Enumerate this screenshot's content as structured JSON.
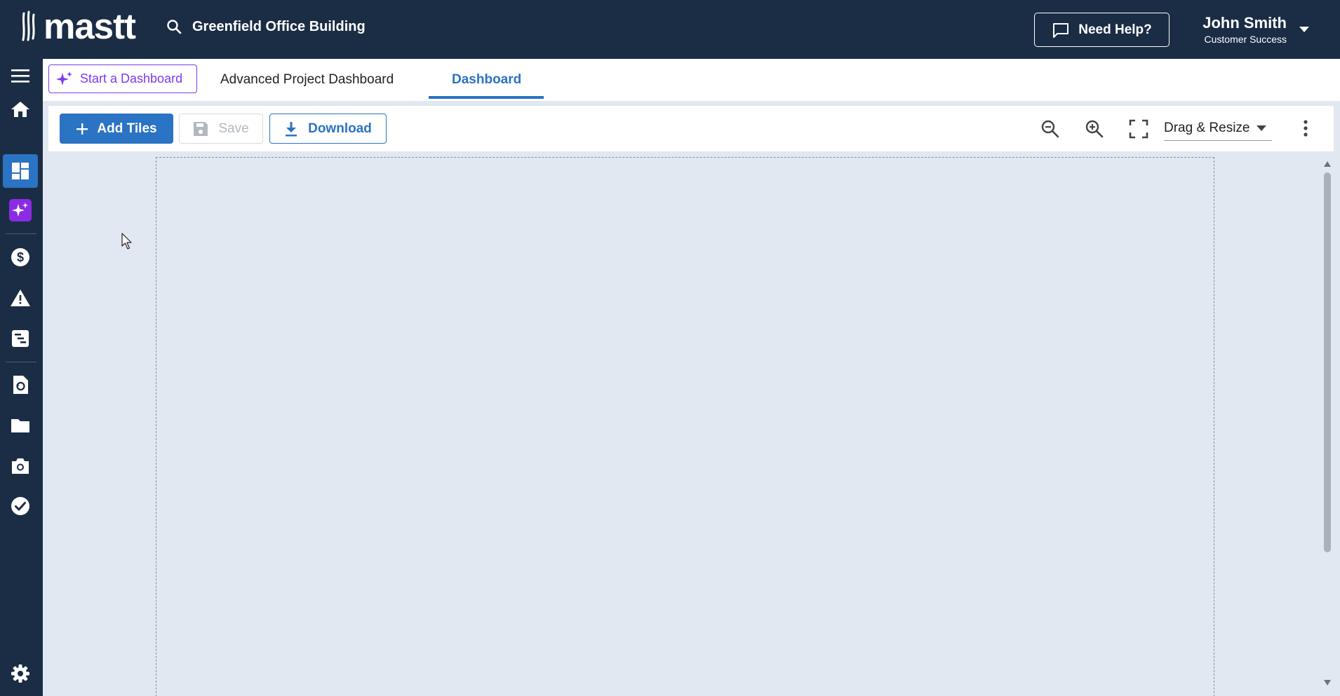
{
  "header": {
    "logo_text": "mastt",
    "project_search": "Greenfield Office Building",
    "help_label": "Need Help?",
    "user_name": "John Smith",
    "user_role": "Customer Success"
  },
  "sidebar": {
    "items": [
      "menu-icon",
      "home-icon",
      "dashboard-icon",
      "ai-sparkle-icon",
      "dollar-icon",
      "warning-icon",
      "schedule-icon",
      "history-icon",
      "folder-icon",
      "camera-icon",
      "check-circle-icon",
      "settings-icon"
    ],
    "active": "dashboard-icon"
  },
  "tabs": {
    "ai_label": "Start a Dashboard",
    "items": [
      "Advanced Project Dashboard",
      "Dashboard"
    ],
    "active": "Dashboard"
  },
  "toolbar": {
    "add_label": "Add Tiles",
    "save_label": "Save",
    "download_label": "Download",
    "mode_value": "Drag & Resize"
  },
  "colors": {
    "nav_bg": "#1b2d45",
    "accent": "#2b73c3",
    "ai_accent": "#7c3aed",
    "canvas_bg": "#e2e8f1"
  }
}
